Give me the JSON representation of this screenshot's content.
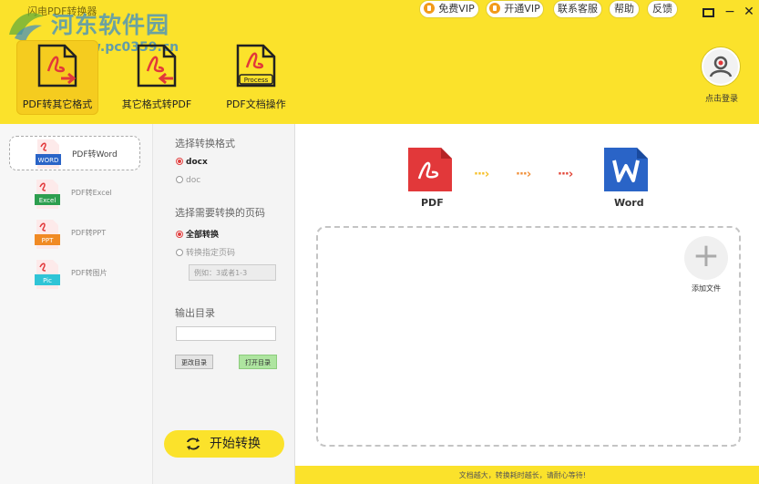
{
  "app": {
    "title": "闪电PDF转换器"
  },
  "watermark": {
    "text": "河东软件园",
    "url": "www.pc0359.cn"
  },
  "top_buttons": [
    {
      "label": "免费VIP",
      "icon": "coin-icon"
    },
    {
      "label": "开通VIP",
      "icon": "coin-icon"
    },
    {
      "label": "联系客服"
    },
    {
      "label": "帮助"
    },
    {
      "label": "反馈"
    }
  ],
  "window_controls": {
    "minimize": "−",
    "close": "✕"
  },
  "nav_tabs": [
    {
      "label": "PDF转其它格式",
      "active": true
    },
    {
      "label": "其它格式转PDF",
      "active": false
    },
    {
      "label": "PDF文档操作",
      "badge": "Process",
      "active": false
    }
  ],
  "login": {
    "label": "点击登录"
  },
  "formats": [
    {
      "label": "PDF转Word",
      "badge": "WORD",
      "active": true
    },
    {
      "label": "PDF转Excel",
      "badge": "Excel"
    },
    {
      "label": "PDF转PPT",
      "badge": "PPT"
    },
    {
      "label": "PDF转图片",
      "badge": "Pic"
    }
  ],
  "options": {
    "format_title": "选择转换格式",
    "format_options": [
      "docx",
      "doc"
    ],
    "selected_format": "docx",
    "pages_title": "选择需要转换的页码",
    "page_options": [
      "全部转换",
      "转换指定页码"
    ],
    "selected_page_option": "全部转换",
    "page_placeholder": "例如：3或者1-3",
    "output_title": "输出目录",
    "output_value": "",
    "change_dir_label": "更改目录",
    "open_dir_label": "打开目录"
  },
  "start_button": {
    "label": "开始转换"
  },
  "conversion": {
    "from": "PDF",
    "to": "Word"
  },
  "add_file": {
    "label": "添加文件"
  },
  "footer": {
    "text": "文档越大，转换耗时越长，请耐心等待!"
  },
  "colors": {
    "brand_yellow": "#fbe22b",
    "pdf_red": "#e2383a",
    "word_blue": "#2a64c7",
    "start_green": "#aee5a0"
  }
}
